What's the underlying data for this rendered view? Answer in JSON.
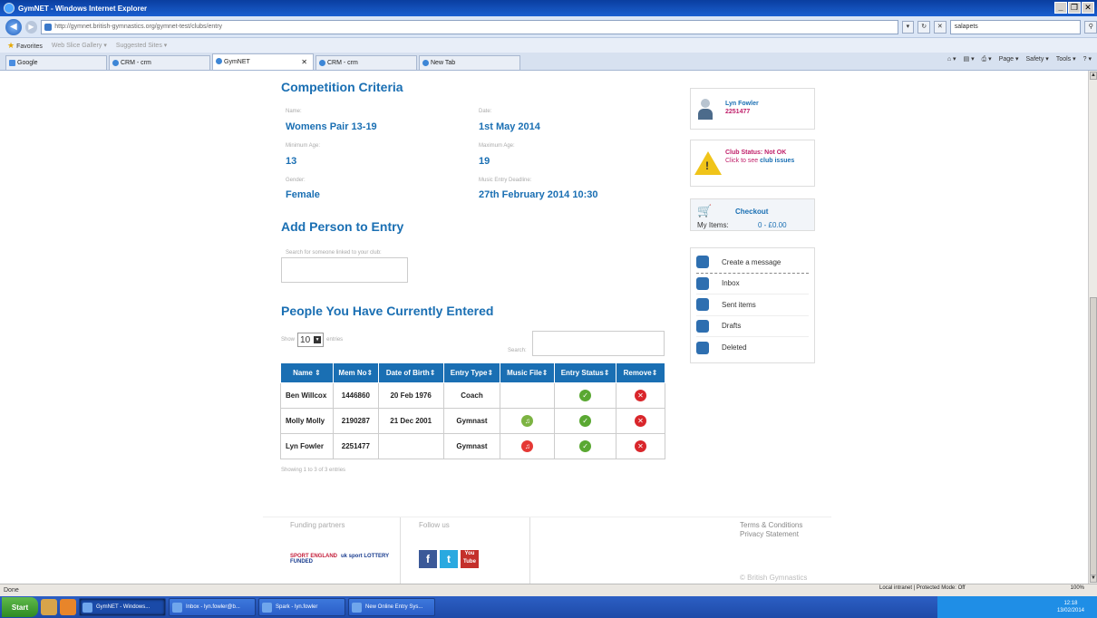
{
  "window": {
    "title": "GymNET - Windows Internet Explorer"
  },
  "browser": {
    "url": "http://gymnet.british-gymnastics.org/gymnet-test/clubs/entry",
    "search_value": "salapets",
    "favorites": {
      "label": "Favorites",
      "web_slice": "Web Slice Gallery ▾",
      "suggested": "Suggested Sites ▾"
    },
    "tabs": [
      {
        "label": "Google"
      },
      {
        "label": "CRM - crm"
      },
      {
        "label": "GymNET",
        "close": "✕"
      },
      {
        "label": "CRM - crm"
      },
      {
        "label": "New Tab"
      }
    ],
    "toolbar": {
      "page": "Page ▾",
      "safety": "Safety ▾",
      "tools": "Tools ▾"
    },
    "status": {
      "left": "Done",
      "zone": "Local intranet | Protected Mode: Off",
      "zoom": "100%"
    }
  },
  "criteria": {
    "heading": "Competition Criteria",
    "name_label": "Name:",
    "name": "Womens Pair 13-19",
    "date_label": "Date:",
    "date": "1st May 2014",
    "min_age_label": "Minimum Age:",
    "min_age": "13",
    "max_age_label": "Maximum Age:",
    "max_age": "19",
    "gender_label": "Gender:",
    "gender": "Female",
    "deadline_label": "Music Entry Deadline:",
    "deadline": "27th February 2014 10:30"
  },
  "add_person": {
    "heading": "Add Person to Entry",
    "search_label": "Search for someone linked to your club:"
  },
  "entered": {
    "heading": "People You Have Currently Entered",
    "show_label": "Show",
    "show_value": "10",
    "entries_label": "entries",
    "search_label": "Search:",
    "columns": [
      "Name",
      "Mem No",
      "Date of Birth",
      "Entry Type",
      "Music File",
      "Entry Status",
      "Remove"
    ],
    "rows": [
      {
        "name": "Ben Willcox",
        "mem_no": "1446860",
        "dob": "20 Feb 1976",
        "type": "Coach",
        "music": ""
      },
      {
        "name": "Molly Molly",
        "mem_no": "2190287",
        "dob": "21 Dec 2001",
        "type": "Gymnast",
        "music": "green"
      },
      {
        "name": "Lyn Fowler",
        "mem_no": "2251477",
        "dob": "",
        "type": "Gymnast",
        "music": "red"
      }
    ],
    "showing": "Showing 1 to 3 of 3 entries"
  },
  "user": {
    "name": "Lyn Fowler",
    "number": "2251477"
  },
  "club_status": {
    "title": "Club Status: Not OK",
    "prefix": "Click to see",
    "link": "club issues"
  },
  "checkout": {
    "label": "Checkout",
    "items_label": "My Items:",
    "items_value": "0 - £0.00"
  },
  "messages": [
    {
      "label": "Create a message"
    },
    {
      "label": "Inbox"
    },
    {
      "label": "Sent items"
    },
    {
      "label": "Drafts"
    },
    {
      "label": "Deleted"
    }
  ],
  "footer": {
    "funding": "Funding partners",
    "follow": "Follow us",
    "sport_england": "SPORT ENGLAND",
    "uk_sport": "uk sport LOTTERY FUNDED",
    "terms": "Terms & Conditions",
    "privacy": "Privacy Statement",
    "copyright": "© British Gymnastics"
  },
  "taskbar": {
    "start": "Start",
    "tasks": [
      {
        "label": "GymNET - Windows..."
      },
      {
        "label": "Inbox - lyn.fowler@b..."
      },
      {
        "label": "Spark - lyn.fowler"
      },
      {
        "label": "New Online Entry Sys..."
      }
    ],
    "time": "12:18",
    "date": "13/02/2014"
  }
}
